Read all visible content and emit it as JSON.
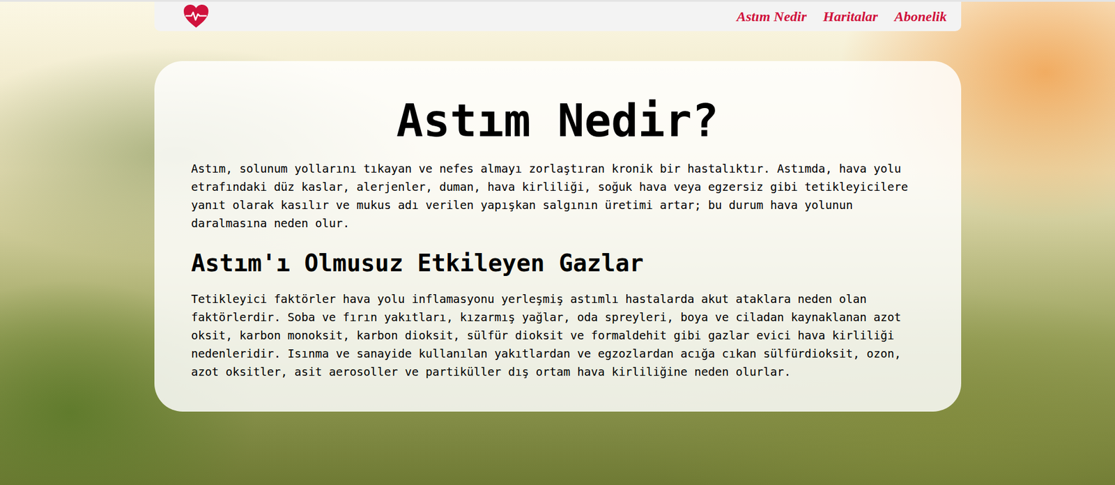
{
  "nav": {
    "links": [
      {
        "label": "Astım Nedir"
      },
      {
        "label": "Haritalar"
      },
      {
        "label": "Abonelik"
      }
    ]
  },
  "article": {
    "title": "Astım Nedir?",
    "intro": "Astım, solunum yollarını tıkayan ve nefes almayı zorlaştıran kronik bir hastalıktır. Astımda, hava yolu etrafındaki düz kaslar, alerjenler, duman, hava kirliliği, soğuk hava veya egzersiz gibi tetikleyicilere yanıt olarak kasılır ve mukus adı verilen yapışkan salgının üretimi artar; bu durum hava yolunun daralmasına neden olur.",
    "subtitle": "Astım'ı Olmusuz Etkileyen Gazlar",
    "body": "Tetikleyici faktörler hava yolu inflamasyonu yerleşmiş astımlı hastalarda akut ataklara neden olan faktörlerdir. Soba ve fırın yakıtları, kızarmış yağlar, oda spreyleri, boya ve ciladan kaynaklanan azot oksit, karbon monoksit, karbon dioksit, sülfür dioksit ve formaldehit gibi gazlar evici hava kirliliği nedenleridir. Isınma ve sanayide kullanılan yakıtlardan ve egzozlardan acığa cıkan sülfürdioksit, ozon, azot oksitler, asit aerosoller ve partiküller dış ortam hava kirliliğine neden olurlar."
  }
}
